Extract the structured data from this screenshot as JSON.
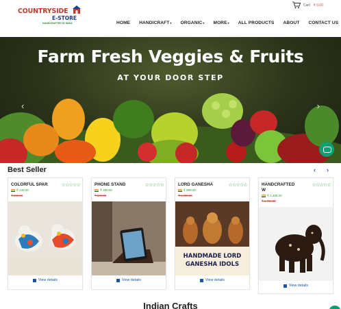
{
  "header": {
    "logo": {
      "line1": "COUNTRYSIDE",
      "line2": "E-STORE",
      "line3": "HANDCRAFTED IN INDIA"
    },
    "cart": {
      "label": "Cart:",
      "amount": "₹ 0.00"
    },
    "nav": [
      {
        "label": "HOME",
        "has_caret": false
      },
      {
        "label": "HANDICRAFT",
        "has_caret": true
      },
      {
        "label": "ORGANIC",
        "has_caret": true
      },
      {
        "label": "MORE",
        "has_caret": true
      },
      {
        "label": "ALL PRODUCTS",
        "has_caret": false
      },
      {
        "label": "ABOUT",
        "has_caret": false
      },
      {
        "label": "CONTACT US",
        "has_caret": false
      }
    ]
  },
  "banner": {
    "title": "Farm Fresh Veggies & Fruits",
    "subtitle": "AT YOUR DOOR STEP",
    "prev": "‹",
    "next": "›"
  },
  "best_seller": {
    "title": "Best Seller",
    "prev": "‹",
    "next": "›",
    "products": [
      {
        "name": "COLORFUL SPAR",
        "name2": "",
        "price": "₹ 249.00",
        "old_price": "₹ 299.00",
        "rating": "☆☆☆☆☆",
        "view": "View details",
        "image_text": ""
      },
      {
        "name": "PHONE STAND",
        "name2": "",
        "price": "₹ 399.00",
        "old_price": "₹ 599.00",
        "rating": "☆☆☆☆☆",
        "view": "View details",
        "image_text": ""
      },
      {
        "name": "LORD GANESHA",
        "name2": "",
        "price": "₹ 899.00",
        "old_price": "₹ 1,000.00",
        "rating": "☆☆☆☆☆",
        "view": "View details",
        "image_text": "HANDMADE LORD GANESHA IDOLS"
      },
      {
        "name": "HANDCRAFTED",
        "name2": "W",
        "price": "₹ 1,499.00",
        "old_price": "₹ 1,700.00",
        "rating": "☆☆☆☆☆",
        "view": "View details",
        "image_text": ""
      }
    ]
  },
  "section2": {
    "title": "Indian Crafts"
  },
  "colors": {
    "brand_red": "#c0392b",
    "brand_blue": "#1f3d8a",
    "accent_green": "#2e9d3a",
    "link_blue": "#1a56a8",
    "chat_green": "#0d9e72"
  }
}
